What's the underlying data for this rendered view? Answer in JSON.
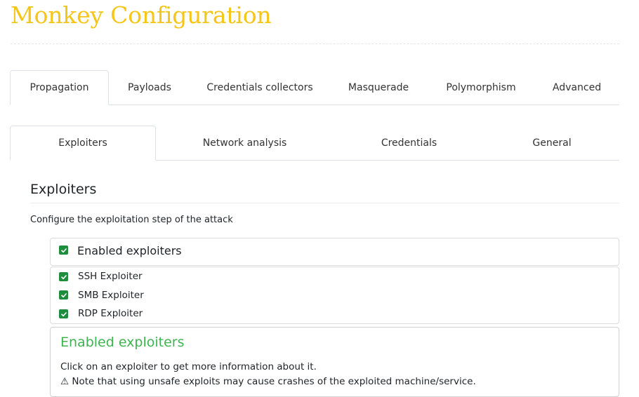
{
  "page": {
    "title": "Monkey Configuration"
  },
  "main_tabs": [
    {
      "label": "Propagation",
      "active": true
    },
    {
      "label": "Payloads",
      "active": false
    },
    {
      "label": "Credentials collectors",
      "active": false
    },
    {
      "label": "Masquerade",
      "active": false
    },
    {
      "label": "Polymorphism",
      "active": false
    },
    {
      "label": "Advanced",
      "active": false
    }
  ],
  "sub_tabs": [
    {
      "label": "Exploiters",
      "active": true
    },
    {
      "label": "Network analysis",
      "active": false
    },
    {
      "label": "Credentials",
      "active": false
    },
    {
      "label": "General",
      "active": false
    }
  ],
  "section": {
    "title": "Exploiters",
    "description": "Configure the exploitation step of the attack"
  },
  "enabled_exploiters": {
    "header_label": "Enabled exploiters",
    "header_checked": true,
    "items": [
      {
        "label": "SSH Exploiter",
        "checked": true
      },
      {
        "label": "SMB Exploiter",
        "checked": true
      },
      {
        "label": "RDP Exploiter",
        "checked": true
      }
    ]
  },
  "info_panel": {
    "title": "Enabled exploiters",
    "text": "Click on an exploiter to get more information about it.",
    "warning": "⚠ Note that using unsafe exploits may cause crashes of the exploited machine/service."
  },
  "colors": {
    "title": "#f5c518",
    "checkbox": "#1e8e3e",
    "info_title": "#3eb34f"
  },
  "icons": {
    "checkbox": "check-icon",
    "warning": "warning-icon"
  }
}
